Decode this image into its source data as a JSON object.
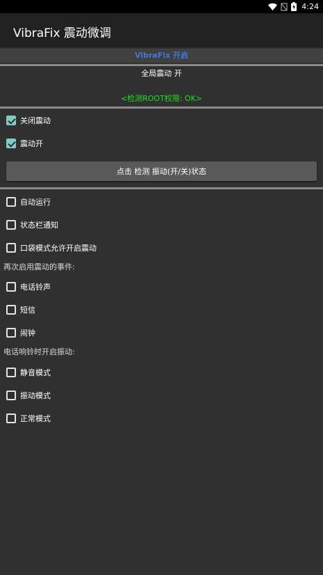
{
  "status_bar": {
    "time": "4:24",
    "icons": [
      "wifi-icon",
      "no-sim-icon",
      "battery-charging-icon"
    ]
  },
  "app_bar": {
    "title": "VibraFix 震动微调"
  },
  "banner": {
    "text": "VibraFix 开启"
  },
  "global_vibration": {
    "text": "全局震动 开"
  },
  "root_check": {
    "text": "<检测ROOT权限: OK>"
  },
  "options_top": [
    {
      "label": "关闭震动",
      "checked": true
    },
    {
      "label": "震动开",
      "checked": true
    }
  ],
  "check_button": {
    "label": "点击 检测 振动(开/关)状态"
  },
  "options_general": [
    {
      "label": "自动运行",
      "checked": false
    },
    {
      "label": "状态栏通知",
      "checked": false
    },
    {
      "label": "口袋模式允许开启震动",
      "checked": false
    }
  ],
  "events_section": {
    "title": "再次启用震动的事件:",
    "items": [
      {
        "label": "电话铃声",
        "checked": false
      },
      {
        "label": "短信",
        "checked": false
      },
      {
        "label": "闹钟",
        "checked": false
      }
    ]
  },
  "ringing_section": {
    "title": "电话响铃时开启振动:",
    "items": [
      {
        "label": "静音模式",
        "checked": false
      },
      {
        "label": "振动模式",
        "checked": false
      },
      {
        "label": "正常模式",
        "checked": false
      }
    ]
  },
  "colors": {
    "accent_check": "#80cbc4",
    "root_ok": "#1ee01e",
    "banner_text": "#3f79d8",
    "background": "#303030"
  }
}
